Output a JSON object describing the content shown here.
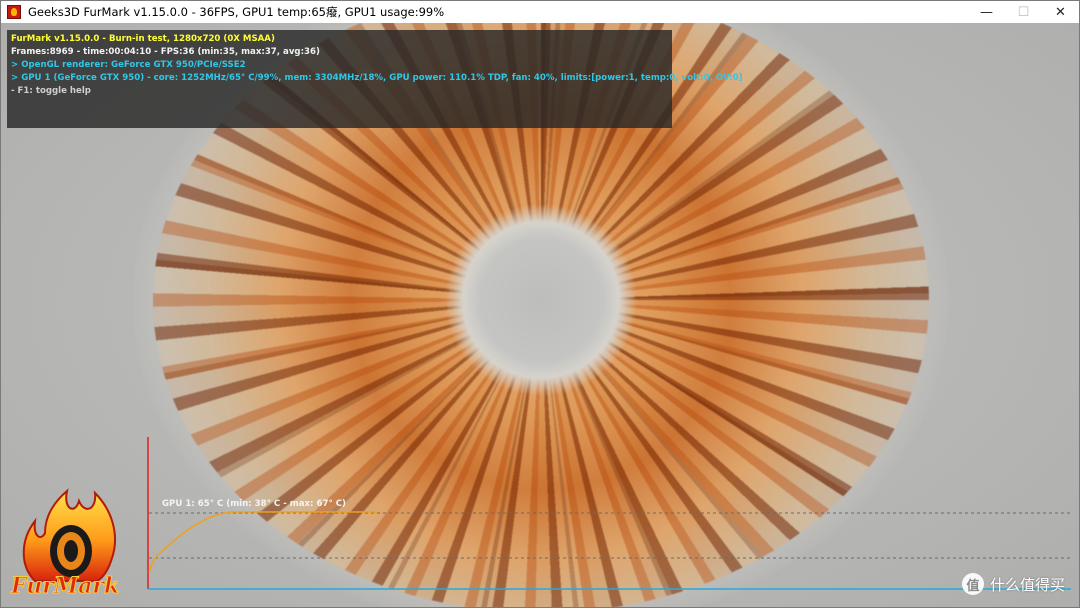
{
  "window": {
    "title": "Geeks3D FurMark v1.15.0.0 - 36FPS, GPU1 temp:65癈, GPU1 usage:99%",
    "controls": {
      "minimize": "—",
      "maximize": "☐",
      "close": "✕"
    }
  },
  "hud": {
    "line1": "FurMark v1.15.0.0 - Burn-in test, 1280x720 (0X MSAA)",
    "line2": "Frames:8969 - time:00:04:10 - FPS:36 (min:35, max:37, avg:36)",
    "line3": "> OpenGL renderer: GeForce GTX 950/PCIe/SSE2",
    "line4": "> GPU 1 (GeForce GTX 950) - core: 1252MHz/65° C/99%, mem: 3304MHz/18%, GPU power: 110.1% TDP, fan: 40%, limits:[power:1, temp:0, volt:0, OV:0]",
    "line5": "- F1: toggle help"
  },
  "graph": {
    "label": "GPU 1: 65° C (min: 38° C - max: 67° C)",
    "colors": {
      "axis_y": "#e02020",
      "axis_x": "#2aa8d8",
      "curve": "#f0a020",
      "grid": "#6a6a6a"
    }
  },
  "logo": {
    "text": "FurMark"
  },
  "watermark": {
    "icon": "值",
    "text": "什么值得买"
  }
}
